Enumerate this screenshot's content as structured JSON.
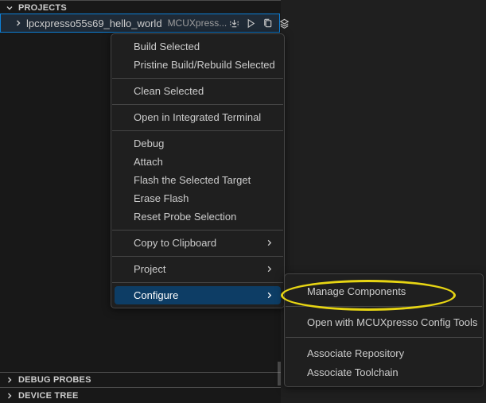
{
  "colors": {
    "sidebar_bg": "#181818",
    "editor_bg": "#1f1f1f",
    "menu_bg": "#1f1f1f",
    "menu_border": "#454545",
    "menu_text": "#cccccc",
    "menu_selection_bg": "#0d3d65",
    "row_selection_bg": "#1f2a36",
    "focus_border": "#0d7fd6",
    "annotation_yellow": "#e7d513",
    "description_text": "#9d9d9d"
  },
  "sidebar": {
    "projects": {
      "header": "PROJECTS"
    },
    "project_row": {
      "name": "lpcxpresso55s69_hello_world",
      "description": "MCUXpress...",
      "actions": [
        {
          "icon": "build-download-icon"
        },
        {
          "icon": "debug-play-icon"
        },
        {
          "icon": "copy-icon"
        },
        {
          "icon": "layers-icon"
        }
      ]
    },
    "debug_probes": {
      "header": "DEBUG PROBES"
    },
    "device_tree": {
      "header": "DEVICE TREE"
    }
  },
  "context_menu": {
    "items": [
      {
        "label": "Build Selected"
      },
      {
        "label": "Pristine Build/Rebuild Selected"
      },
      {
        "label": "Clean Selected"
      },
      {
        "label": "Open in Integrated Terminal"
      },
      {
        "label": "Debug"
      },
      {
        "label": "Attach"
      },
      {
        "label": "Flash the Selected Target"
      },
      {
        "label": "Erase Flash"
      },
      {
        "label": "Reset Probe Selection"
      },
      {
        "label": "Copy to Clipboard",
        "has_submenu": true
      },
      {
        "label": "Project",
        "has_submenu": true
      },
      {
        "label": "Configure",
        "has_submenu": true,
        "selected": true
      }
    ]
  },
  "submenu": {
    "items": [
      {
        "label": "Manage Components",
        "annotated": true
      },
      {
        "label": "Open with MCUXpresso Config Tools"
      },
      {
        "label": "Associate Repository"
      },
      {
        "label": "Associate Toolchain"
      }
    ]
  },
  "annotation": {
    "shape": "ellipse",
    "color": "#e7d513",
    "highlights": "Manage Components"
  }
}
